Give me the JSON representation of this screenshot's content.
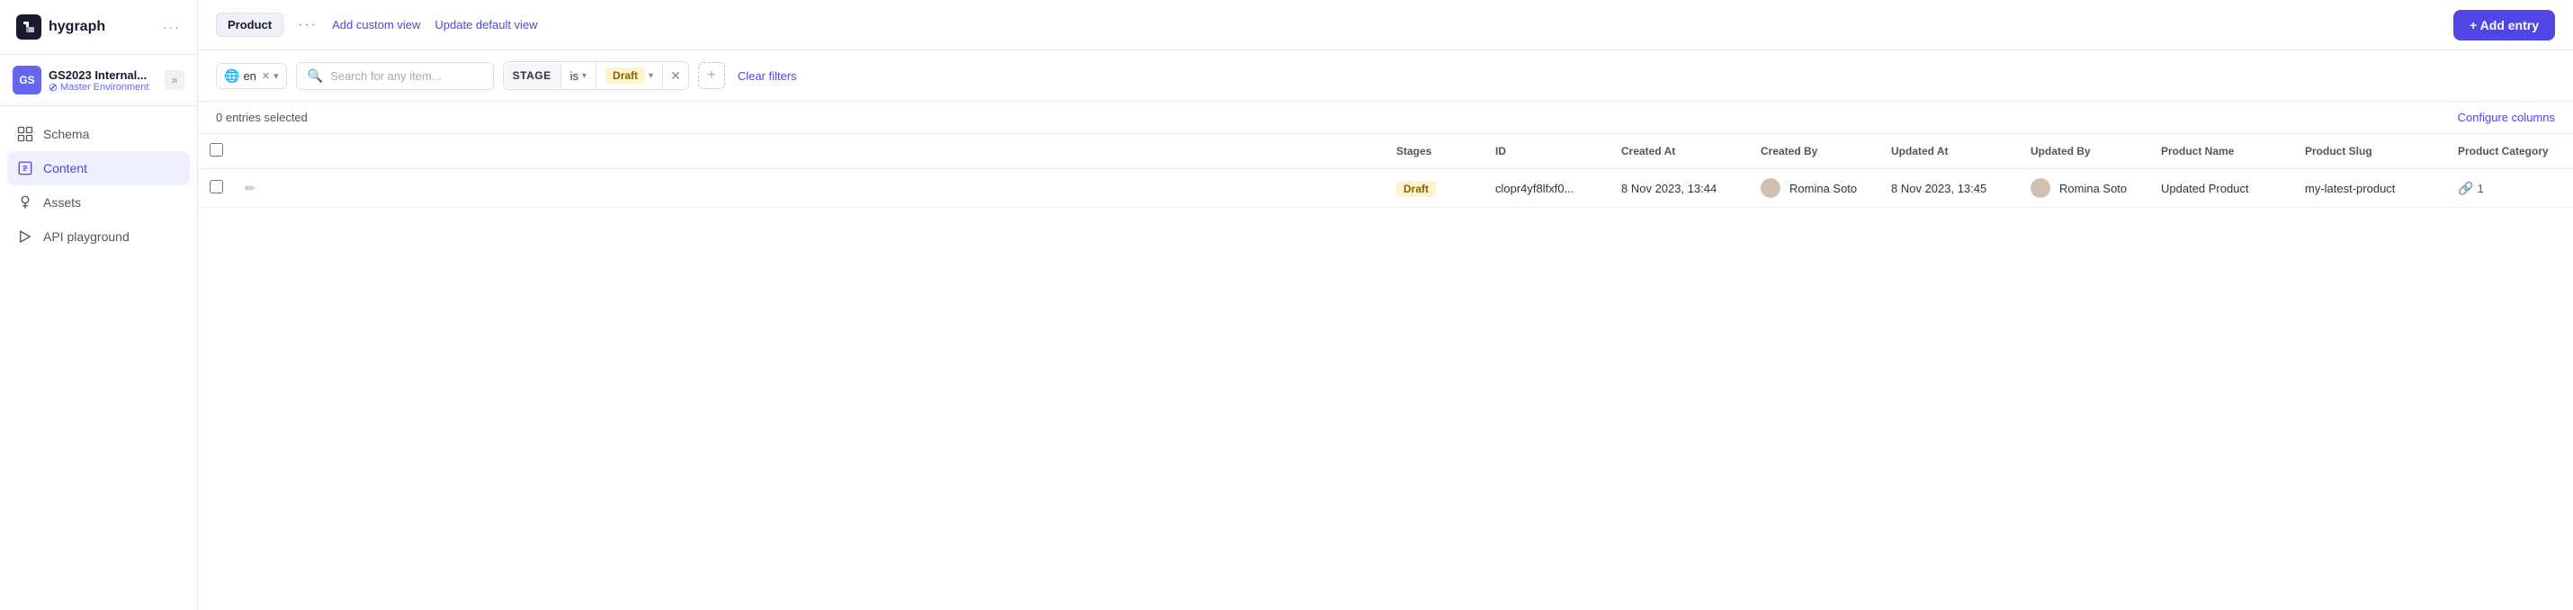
{
  "sidebar": {
    "logo": {
      "mark": "G",
      "text": "hygraph",
      "dots": "···"
    },
    "workspace": {
      "initials": "GS",
      "name": "GS2023 Internal...",
      "env": "Master Environment",
      "expand": "»"
    },
    "nav": [
      {
        "id": "schema",
        "label": "Schema",
        "active": false
      },
      {
        "id": "content",
        "label": "Content",
        "active": true
      },
      {
        "id": "assets",
        "label": "Assets",
        "active": false
      },
      {
        "id": "api-playground",
        "label": "API playground",
        "active": false
      }
    ]
  },
  "topbar": {
    "tab": "Product",
    "dots": "···",
    "custom_view": "Add custom view",
    "update_view": "Update default view",
    "add_entry": "+ Add entry"
  },
  "filterbar": {
    "lang_code": "en",
    "search_placeholder": "Search for any item...",
    "stage_label": "STAGE",
    "stage_operator": "is",
    "stage_value": "Draft",
    "clear_filters": "Clear filters"
  },
  "table": {
    "entries_count": "0 entries selected",
    "configure_columns": "Configure columns",
    "columns": [
      "Stages",
      "ID",
      "Created At",
      "Created By",
      "Updated At",
      "Updated By",
      "Product Name",
      "Product Slug",
      "Product Category"
    ],
    "rows": [
      {
        "stage": "Draft",
        "id": "clopr4yf8lfxf0...",
        "created_at": "8 Nov 2023, 13:44",
        "created_by": "Romina Soto",
        "updated_at": "8 Nov 2023, 13:45",
        "updated_by": "Romina Soto",
        "product_name": "Updated Product",
        "product_slug": "my-latest-product",
        "product_category": "1"
      }
    ]
  }
}
